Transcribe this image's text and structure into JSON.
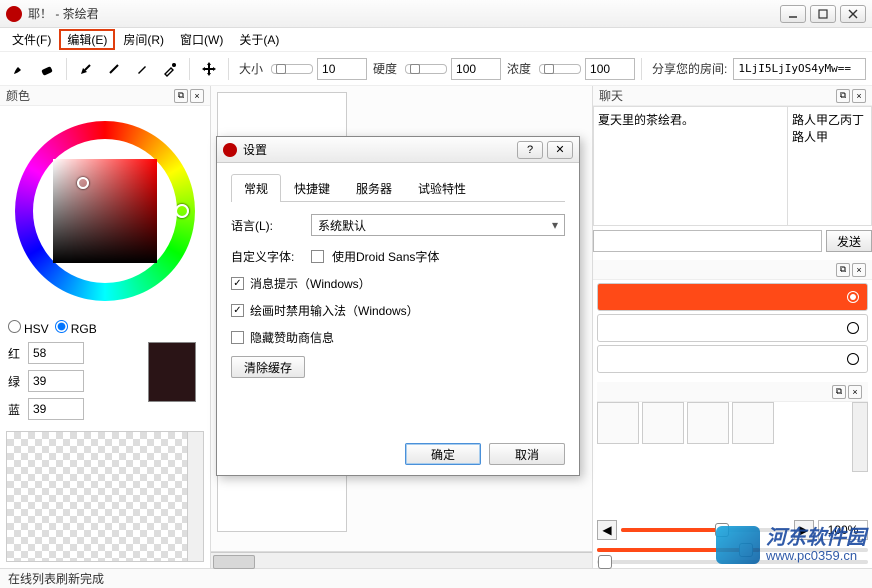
{
  "window": {
    "title": "耶！ - 茶绘君"
  },
  "menubar": {
    "file": "文件(F)",
    "edit": "编辑(E)",
    "room": "房间(R)",
    "window": "窗口(W)",
    "about": "关于(A)"
  },
  "toolbar": {
    "size_label": "大小",
    "size_value": "10",
    "hardness_label": "硬度",
    "hardness_value": "100",
    "opacity_label": "浓度",
    "opacity_value": "100",
    "share_label": "分享您的房间:",
    "share_value": "1LjI5LjIyOS4yMw=="
  },
  "color_panel": {
    "title": "颜色",
    "hsv": "HSV",
    "rgb": "RGB",
    "r_label": "红",
    "g_label": "绿",
    "b_label": "蓝",
    "r": "58",
    "g": "39",
    "b": "39"
  },
  "chat": {
    "title": "聊天",
    "line1": "夏天里的茶绘君。",
    "user1": "路人甲乙丙丁",
    "user2": "路人甲",
    "send": "发送"
  },
  "zoom": {
    "value": "100%"
  },
  "statusbar": {
    "text": "在线列表刷新完成"
  },
  "modal": {
    "title": "设置",
    "tabs": {
      "general": "常规",
      "shortcuts": "快捷键",
      "server": "服务器",
      "experimental": "试验特性"
    },
    "language_label": "语言(L):",
    "language_value": "系统默认",
    "font_label": "自定义字体:",
    "use_droid": "使用Droid Sans字体",
    "msg_tip": "消息提示（Windows）",
    "disable_ime": "绘画时禁用输入法（Windows）",
    "hide_sponsor": "隐藏赞助商信息",
    "clear_cache": "清除缓存",
    "ok": "确定",
    "cancel": "取消"
  },
  "watermark": {
    "cn": "河东软件园",
    "url": "www.pc0359.cn"
  }
}
